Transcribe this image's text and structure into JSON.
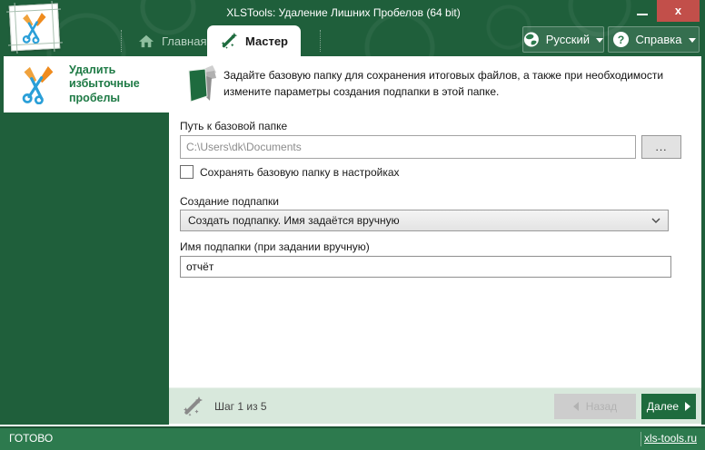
{
  "window": {
    "title": "XLSTools: Удаление Лишних Пробелов (64 bit)",
    "close_label": "x"
  },
  "tabs": {
    "home": "Главная",
    "master": "Мастер"
  },
  "topbar": {
    "language": "Русский",
    "help": "Справка"
  },
  "sidebar": {
    "title": "Удалить избыточные пробелы"
  },
  "main": {
    "description": "Задайте базовую папку для сохранения итоговых файлов, а также при необходимости измените параметры создания подпапки в этой папке.",
    "base_path": {
      "label": "Путь к базовой папке",
      "value": "C:\\Users\\dk\\Documents",
      "browse_label": "..."
    },
    "save_checkbox": {
      "label": "Сохранять базовую папку в настройках",
      "checked": false
    },
    "subfolder_mode": {
      "label": "Создание подпапки",
      "value": "Создать подпапку. Имя задаётся вручную"
    },
    "subfolder_name": {
      "label": "Имя подпапки (при задании вручную)",
      "value": "отчёт"
    }
  },
  "footer": {
    "step_text": "Шаг 1 из 5",
    "back_label": "Назад",
    "next_label": "Далее"
  },
  "statusbar": {
    "status": "ГОТОВО",
    "link": "xls-tools.ru"
  },
  "colors": {
    "header_green": "#1f5f3b",
    "accent_green": "#1e6b3e",
    "status_green": "#2d7a4e",
    "footer_bg": "#d8e8dc",
    "close_red": "#c24f4a"
  }
}
